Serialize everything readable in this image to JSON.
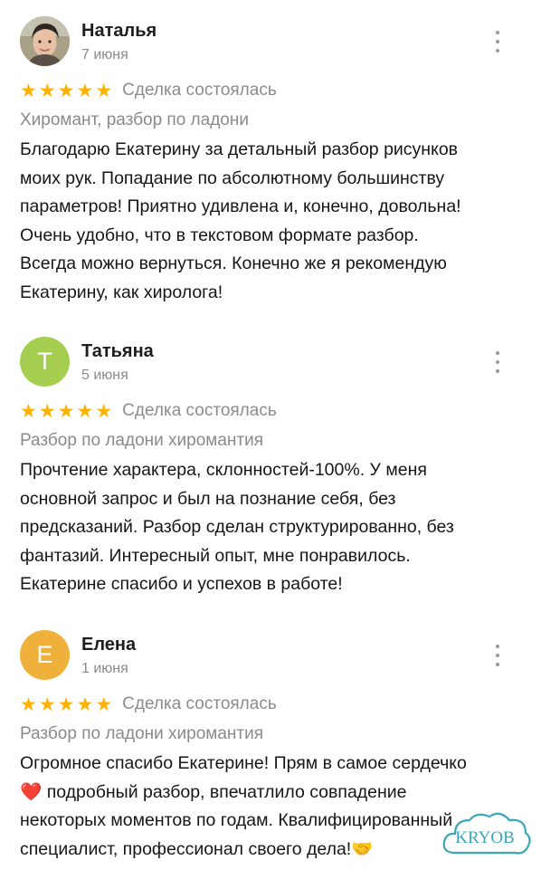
{
  "reviews": [
    {
      "name": "Наталья",
      "date": "7 июня",
      "avatar_letter": "",
      "avatar_color": "#b9a98f",
      "rating": 5,
      "deal_status": "Сделка состоялась",
      "service": "Хиромант, разбор по ладони",
      "text_lines": [
        "Благодарю Екатерину за детальный разбор рисунков",
        "моих рук. Попадание по абсолютному большинству",
        "параметров! Приятно удивлена и, конечно, довольна!",
        "Очень удобно, что в текстовом формате разбор.",
        "Всегда можно вернуться. Конечно же я рекомендую",
        "Екатерину, как хиролога!"
      ]
    },
    {
      "name": "Татьяна",
      "date": "5 июня",
      "avatar_letter": "Т",
      "avatar_color": "#a6cf52",
      "rating": 5,
      "deal_status": "Сделка состоялась",
      "service": "Разбор по ладони хиромантия",
      "text_lines": [
        "Прочтение характера, склонностей-100%. У меня",
        "основной запрос и был на познание себя, без",
        "предсказаний. Разбор сделан структурированно, без",
        "фантазий. Интересный опыт, мне понравилось.",
        "Екатерине спасибо и успехов в работе!"
      ]
    },
    {
      "name": "Елена",
      "date": "1 июня",
      "avatar_letter": "Е",
      "avatar_color": "#f0b13c",
      "rating": 5,
      "deal_status": "Сделка состоялась",
      "service": "Разбор по ладони хиромантия",
      "text_lines": [
        "Огромное спасибо Екатерине! Прям в самое сердечко",
        "❤️  подробный разбор, впечатлило совпадение",
        "некоторых моментов по годам. Квалифицированный",
        "специалист, профессионал своего дела!🤝"
      ]
    }
  ],
  "watermark": "KRYOB",
  "icons": {
    "star": "star-icon",
    "menu": "more-vertical-icon"
  },
  "colors": {
    "star": "#ffb300",
    "muted_text": "#8a8a8a",
    "watermark": "#3aa8b8"
  }
}
